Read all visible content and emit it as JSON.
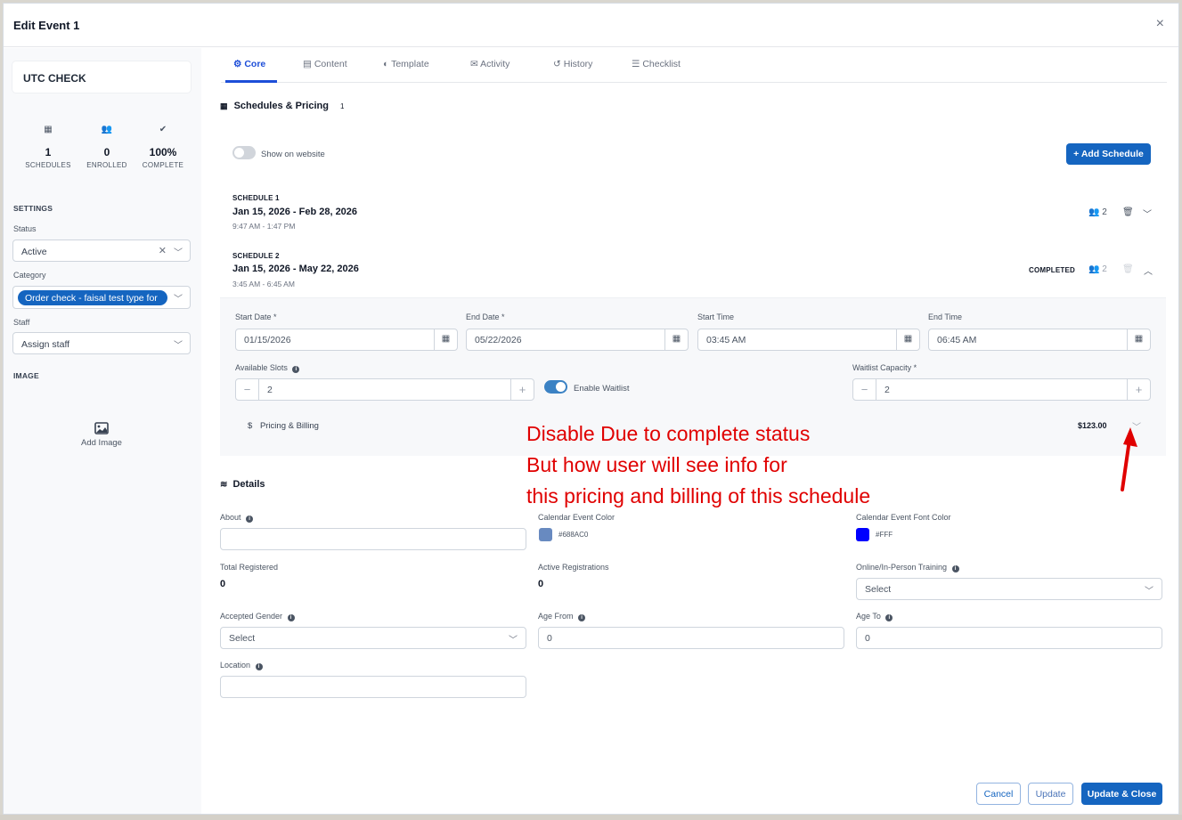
{
  "modal": {
    "title": "Edit Event 1",
    "close": "×"
  },
  "sidebar": {
    "event_name": "UTC CHECK",
    "stats": [
      {
        "icon": "calendar-icon",
        "glyph": "▦",
        "value": "1",
        "label": "SCHEDULES"
      },
      {
        "icon": "users-icon",
        "glyph": "👥",
        "value": "0",
        "label": "ENROLLED"
      },
      {
        "icon": "check-circle-icon",
        "glyph": "✔",
        "value": "100%",
        "label": "COMPLETE"
      }
    ],
    "settings_heading": "SETTINGS",
    "status_label": "Status",
    "status_value": "Active",
    "category_label": "Category",
    "category_value": "Order check - faisal test type for",
    "staff_label": "Staff",
    "staff_placeholder": "Assign staff",
    "image_heading": "IMAGE",
    "add_image_label": "Add Image"
  },
  "tabs": [
    {
      "label": "Core",
      "icon": "gear-icon",
      "glyph": "⚙",
      "active": true
    },
    {
      "label": "Content",
      "icon": "document-icon",
      "glyph": "▤",
      "active": false
    },
    {
      "label": "Template",
      "icon": "palette-icon",
      "glyph": "◐",
      "active": false
    },
    {
      "label": "Activity",
      "icon": "chat-icon",
      "glyph": "✉",
      "active": false
    },
    {
      "label": "History",
      "icon": "history-icon",
      "glyph": "↺",
      "active": false
    },
    {
      "label": "Checklist",
      "icon": "checklist-icon",
      "glyph": "☰",
      "active": false
    }
  ],
  "schedules_section": {
    "title": "Schedules & Pricing",
    "count": "1",
    "show_on_website_label": "Show on website",
    "show_on_website": false,
    "add_schedule_label": "+ Add Schedule"
  },
  "schedule1": {
    "kicker": "SCHEDULE 1",
    "dates": "Jan 15, 2026 - Feb 28, 2026",
    "time": "9:47 AM - 1:47 PM",
    "enrolled": "2"
  },
  "schedule2": {
    "kicker": "SCHEDULE 2",
    "dates": "Jan 15, 2026 - May 22, 2026",
    "time": "3:45 AM - 6:45 AM",
    "status": "COMPLETED",
    "enrolled": "2",
    "start_date_label": "Start Date *",
    "start_date": "01/15/2026",
    "end_date_label": "End Date *",
    "end_date": "05/22/2026",
    "start_time_label": "Start Time",
    "start_time": "03:45 AM",
    "end_time_label": "End Time",
    "end_time": "06:45 AM",
    "available_slots_label": "Available Slots",
    "available_slots": "2",
    "enable_waitlist_label": "Enable Waitlist",
    "enable_waitlist": true,
    "waitlist_capacity_label": "Waitlist Capacity *",
    "waitlist_capacity": "2",
    "pricing_label": "Pricing & Billing",
    "pricing_symbol": "$",
    "pricing_value": "$123.00"
  },
  "annotation": {
    "line1": "Disable Due to complete status",
    "line2": "But how user will see info for",
    "line3": "this pricing and billing of this schedule",
    "color": "#e00000"
  },
  "details": {
    "title": "Details",
    "about_label": "About",
    "about_value": "",
    "calendar_color_label": "Calendar Event Color",
    "calendar_color_value": "#688AC0",
    "calendar_font_color_label": "Calendar Event Font Color",
    "calendar_font_color_value": "#FFF",
    "total_registered_label": "Total Registered",
    "total_registered": "0",
    "active_registrations_label": "Active Registrations",
    "active_registrations": "0",
    "training_label": "Online/In-Person Training",
    "training_value": "Select",
    "gender_label": "Accepted Gender",
    "gender_value": "Select",
    "age_from_label": "Age From",
    "age_from": "0",
    "age_to_label": "Age To",
    "age_to": "0",
    "location_label": "Location",
    "location_value": ""
  },
  "footer": {
    "cancel_label": "Cancel",
    "update_label": "Update",
    "update_close_label": "Update & Close"
  },
  "colors": {
    "primary": "#1565C0",
    "calendar_swatch": "#688AC0",
    "font_swatch": "#0000FF",
    "toggle_on": "#3b82c4",
    "toggle_off": "#d1d5db"
  }
}
